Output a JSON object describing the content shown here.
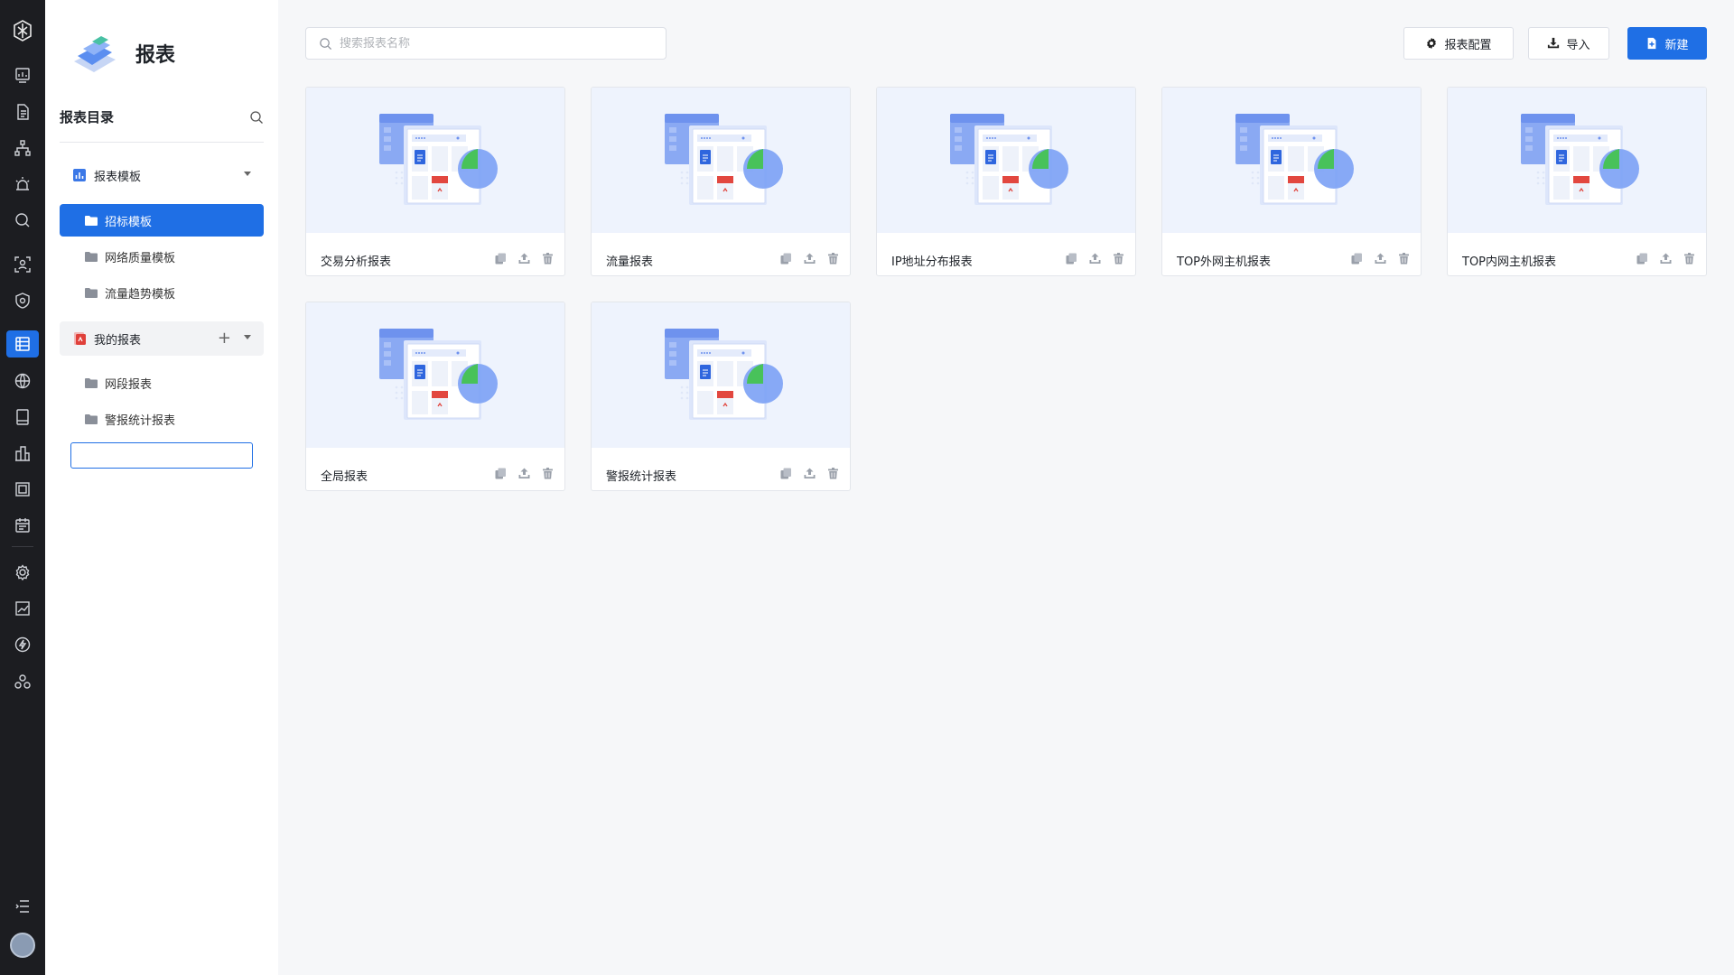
{
  "app": {
    "title": "报表",
    "colors": {
      "primary": "#1f6fe5",
      "rail_bg": "#1c1d21",
      "thumb_bg": "#eef3fd"
    }
  },
  "rail": {
    "items": [
      {
        "icon": "dashboard-icon"
      },
      {
        "icon": "document-icon"
      },
      {
        "icon": "topology-icon"
      },
      {
        "icon": "alarm-icon"
      },
      {
        "icon": "search-icon"
      },
      {
        "icon": "face-scan-icon"
      },
      {
        "icon": "security-shield-icon"
      },
      {
        "icon": "report-icon",
        "active": true
      },
      {
        "icon": "globe-icon"
      },
      {
        "icon": "device-icon"
      },
      {
        "icon": "building-icon"
      },
      {
        "icon": "chip-icon"
      },
      {
        "icon": "calendar-icon"
      },
      {
        "icon": "settings-icon"
      },
      {
        "icon": "trend-icon"
      },
      {
        "icon": "flash-icon"
      },
      {
        "icon": "cluster-icon"
      }
    ],
    "bottom": [
      {
        "icon": "collapse-menu-icon"
      },
      {
        "icon": "user-avatar"
      }
    ]
  },
  "catalog": {
    "title": "报表目录",
    "template_group": {
      "label": "报表模板",
      "items": [
        "招标模板",
        "网络质量模板",
        "流量趋势模板"
      ],
      "active_index": 0
    },
    "my_group": {
      "label": "我的报表",
      "items": [
        "网段报表",
        "警报统计报表"
      ]
    },
    "new_folder_value": ""
  },
  "toolbar": {
    "search_placeholder": "搜索报表名称",
    "config_label": "报表配置",
    "import_label": "导入",
    "new_label": "新建"
  },
  "cards": [
    {
      "name": "交易分析报表"
    },
    {
      "name": "流量报表"
    },
    {
      "name": "IP地址分布报表"
    },
    {
      "name": "TOP外网主机报表"
    },
    {
      "name": "TOP内网主机报表"
    },
    {
      "name": "全局报表"
    },
    {
      "name": "警报统计报表"
    }
  ],
  "card_actions": [
    {
      "icon": "copy-icon"
    },
    {
      "icon": "export-icon"
    },
    {
      "icon": "delete-icon"
    }
  ]
}
